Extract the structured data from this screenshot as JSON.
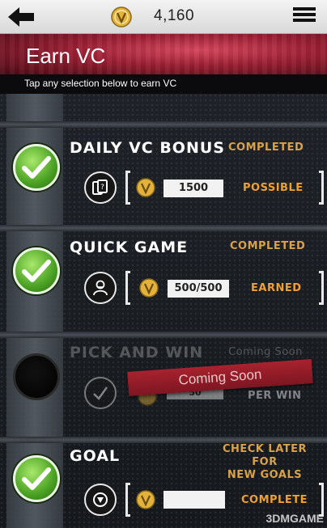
{
  "header": {
    "vc_balance": "4,160",
    "title": "Earn VC",
    "subtitle": "Tap any selection below to earn VC"
  },
  "items": [
    {
      "title": "DAILY VC BONUS",
      "status": "COMPLETED",
      "type_icon": "cards-icon",
      "value": "1500",
      "value_label": "POSSIBLE",
      "done": true
    },
    {
      "title": "QUICK GAME",
      "status": "COMPLETED",
      "type_icon": "player-icon",
      "value": "500/500",
      "value_label": "EARNED",
      "done": true
    },
    {
      "title": "PICK AND WIN",
      "status": "Coming Soon",
      "type_icon": "check-icon",
      "value": "50",
      "value_label": "PER WIN",
      "ribbon": "Coming Soon",
      "done": false
    },
    {
      "title": "GOAL",
      "status_line1": "CHECK LATER FOR",
      "status_line2": "NEW GOALS",
      "type_icon": "goal-icon",
      "value": "",
      "value_label": "COMPLETE",
      "done": true
    }
  ],
  "watermark": "3DMGAME",
  "colors": {
    "accent_gold": "#d9a24a",
    "value_orange": "#f0a030",
    "check_green": "#4aa123",
    "ribbon_red": "#a8222f"
  }
}
